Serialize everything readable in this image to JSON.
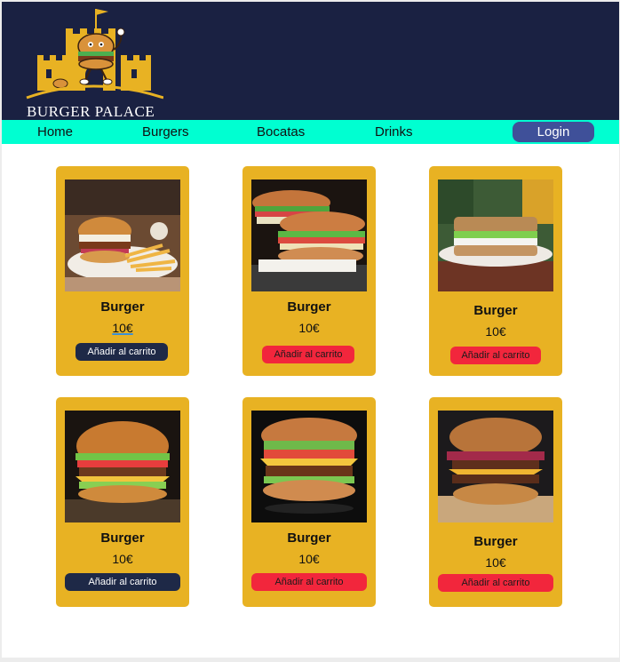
{
  "header": {
    "brand": "BURGER PALACE"
  },
  "nav": {
    "items": [
      "Home",
      "Burgers",
      "Bocatas",
      "Drinks"
    ],
    "login": "Login"
  },
  "products": [
    {
      "name": "Burger",
      "price": "10€",
      "button": "Añadir al carrito",
      "button_style": "dark"
    },
    {
      "name": "Burger",
      "price": "10€",
      "button": "Añadir al carrito",
      "button_style": "red"
    },
    {
      "name": "Burger",
      "price": "10€",
      "button": "Añadir al carrito",
      "button_style": "red"
    },
    {
      "name": "Burger",
      "price": "10€",
      "button": "Añadir al carrito",
      "button_style": "dark"
    },
    {
      "name": "Burger",
      "price": "10€",
      "button": "Añadir al carrito",
      "button_style": "red"
    },
    {
      "name": "Burger",
      "price": "10€",
      "button": "Añadir al carrito",
      "button_style": "red"
    }
  ],
  "colors": {
    "header_bg": "#1a2142",
    "nav_bg": "#00ffd1",
    "card_bg": "#e8b223",
    "login_bg": "#3f5099",
    "button_dark": "#1e2947",
    "button_red": "#f2263c"
  }
}
